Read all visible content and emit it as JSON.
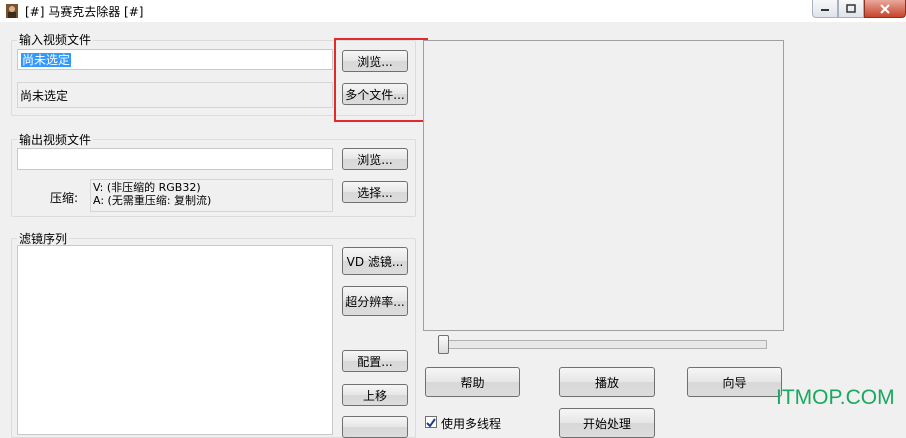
{
  "window": {
    "title": "[#] 马赛克去除器 [#]",
    "controls": [
      "minimize-icon",
      "maximize-icon",
      "close-icon"
    ]
  },
  "input": {
    "group_label": "输入视频文件",
    "file_value": "尚未选定",
    "status_text": "尚未选定",
    "browse_label": "浏览...",
    "multi_label": "多个文件..."
  },
  "output": {
    "group_label": "输出视频文件",
    "file_value": "",
    "browse_label": "浏览...",
    "compress_label": "压缩:",
    "compress_video": "V: (非压缩的 RGB32)",
    "compress_audio": "A: (无需重压缩: 复制流)",
    "select_label": "选择..."
  },
  "filters": {
    "group_label": "滤镜序列",
    "vd_label": "VD 滤镜...",
    "superres_label": "超分辨率...",
    "config_label": "配置...",
    "up_label": "上移"
  },
  "player": {
    "help_label": "帮助",
    "play_label": "播放",
    "wizard_label": "向导",
    "multithread_label": "使用多线程",
    "bottom_btn_label": "开始处理"
  },
  "watermark": "ITMOP.COM",
  "colors": {
    "highlight": "#e32a2a",
    "selection": "#3399ff",
    "watermark": "#1aa860"
  }
}
